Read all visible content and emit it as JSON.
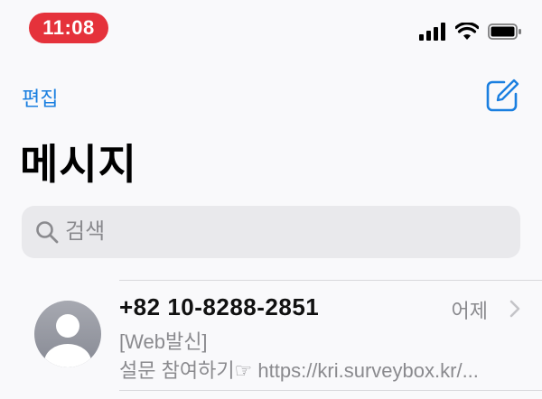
{
  "status_bar": {
    "time": "11:08",
    "icons": [
      "cellular-signal-icon",
      "wifi-icon",
      "battery-icon"
    ],
    "time_pill_color": "#e5323b"
  },
  "nav": {
    "edit_label": "편집",
    "compose_icon": "compose-icon",
    "accent_color": "#1a7fe0"
  },
  "page_title": "메시지",
  "search": {
    "placeholder": "검색"
  },
  "conversations": [
    {
      "sender": "+82 10-8288-2851",
      "date": "어제",
      "preview_line_1": "[Web발신]",
      "preview_line_2": "설문 참여하기☞ https://kri.surveybox.kr/..."
    }
  ]
}
